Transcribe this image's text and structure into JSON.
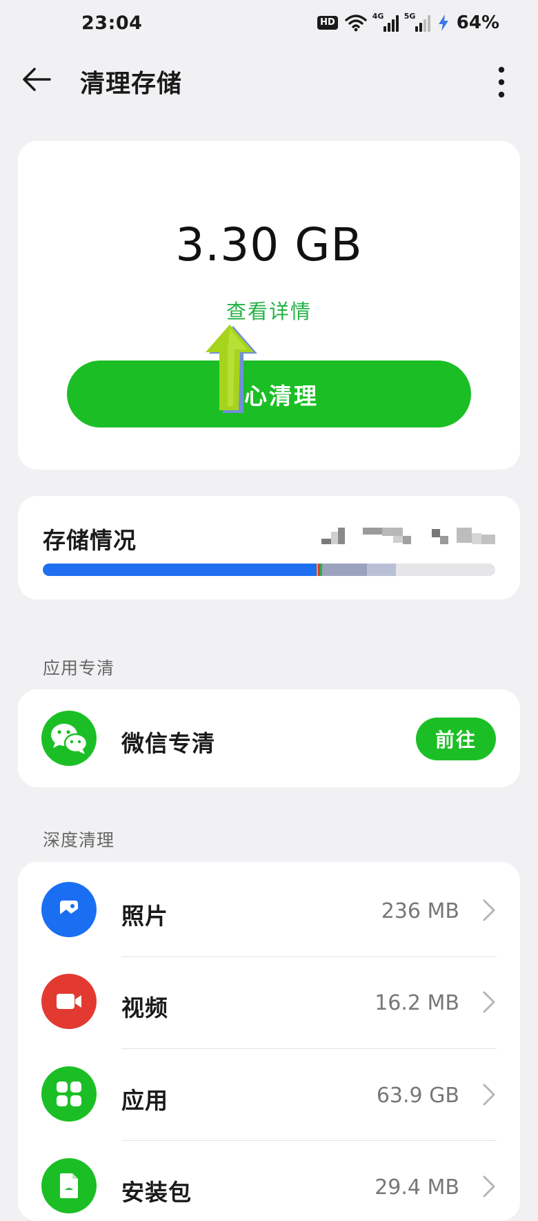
{
  "status_bar": {
    "time": "23:04",
    "hd_badge": "HD",
    "net1_label": "4G",
    "net2_label": "5G",
    "battery": "64%"
  },
  "header": {
    "title": "清理存储",
    "back_icon": "arrow-left-icon",
    "more_icon": "more-vertical-icon"
  },
  "summary": {
    "size": "3.30 GB",
    "details_link": "查看详情",
    "clean_button": "放心清理"
  },
  "storage": {
    "title": "存储情况",
    "segments": [
      {
        "color": "#1f6ef0",
        "fraction": 0.605
      },
      {
        "color": "#e8a818",
        "fraction": 0.004
      },
      {
        "color": "#e23a2e",
        "fraction": 0.004
      },
      {
        "color": "#24b14a",
        "fraction": 0.004
      },
      {
        "color": "#9aa2bd",
        "fraction": 0.1
      },
      {
        "color": "#b9c0d6",
        "fraction": 0.063
      }
    ]
  },
  "app_clean": {
    "section_label": "应用专清",
    "item_label": "微信专清",
    "go_button": "前往",
    "icon": "wechat-icon"
  },
  "deep_clean": {
    "section_label": "深度清理",
    "items": [
      {
        "label": "照片",
        "size": "236 MB",
        "icon": "photo-icon",
        "color": "#1a6ef2"
      },
      {
        "label": "视频",
        "size": "16.2 MB",
        "icon": "video-icon",
        "color": "#e23a31"
      },
      {
        "label": "应用",
        "size": "63.9 GB",
        "icon": "apps-grid-icon",
        "color": "#1bbf25"
      },
      {
        "label": "安装包",
        "size": "29.4 MB",
        "icon": "apk-file-icon",
        "color": "#1bbf25"
      }
    ]
  }
}
